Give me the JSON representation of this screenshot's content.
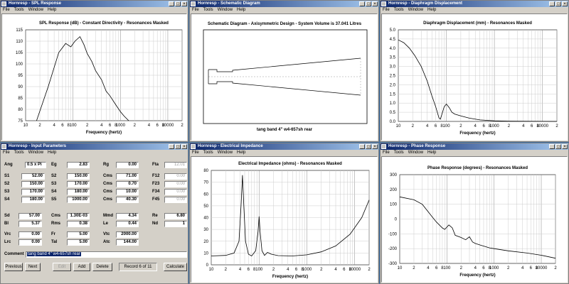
{
  "menu": [
    "File",
    "Tools",
    "Window",
    "Help"
  ],
  "windows": {
    "spl": {
      "title": "Hornresp - SPL Response"
    },
    "schematic": {
      "title": "Hornresp - Schematic Diagram"
    },
    "displacement": {
      "title": "Hornresp - Diaphragm Displacement"
    },
    "input": {
      "title": "Hornresp - Input Parameters"
    },
    "impedance": {
      "title": "Hornresp - Electrical Impedance"
    },
    "phase": {
      "title": "Hornresp - Phase Response"
    }
  },
  "log_axis": {
    "ticks": [
      "10",
      "2",
      "4",
      "6",
      "8",
      "100",
      "2",
      "4",
      "6",
      "8",
      "1000",
      "2",
      "4",
      "6",
      "8",
      "10000",
      "2"
    ],
    "label": "Frequency (hertz)"
  },
  "schematic": {
    "title": "Schematic Diagram - Axisymmetric Design - System Volume is 37.041 Litres",
    "caption": "tang band 4\" w4-657sh rear"
  },
  "input_params": {
    "row1": [
      {
        "label": "Ang",
        "value": "0.5 x Pi"
      },
      {
        "label": "Eg",
        "value": "2.83"
      },
      {
        "label": "Rg",
        "value": "0.00"
      },
      {
        "label": "Fta",
        "value": "12.01",
        "disabled": true
      }
    ],
    "block2": [
      [
        {
          "label": "S1",
          "value": "52.00"
        },
        {
          "label": "S2",
          "value": "150.00"
        },
        {
          "label": "Cms",
          "value": "71.00"
        },
        {
          "label": "F12",
          "value": "0.00",
          "disabled": true
        }
      ],
      [
        {
          "label": "S2",
          "value": "150.00"
        },
        {
          "label": "S3",
          "value": "170.00"
        },
        {
          "label": "Cms",
          "value": "0.70"
        },
        {
          "label": "F23",
          "value": "0.00",
          "disabled": true
        }
      ],
      [
        {
          "label": "S3",
          "value": "170.00"
        },
        {
          "label": "S4",
          "value": "180.00"
        },
        {
          "label": "Cms",
          "value": "10.00"
        },
        {
          "label": "F34",
          "value": "0.00",
          "disabled": true
        }
      ],
      [
        {
          "label": "S4",
          "value": "180.00"
        },
        {
          "label": "S5",
          "value": "1000.00"
        },
        {
          "label": "Cms",
          "value": "40.30"
        },
        {
          "label": "F45",
          "value": "0.00",
          "disabled": true
        }
      ]
    ],
    "block3": [
      [
        {
          "label": "Sd",
          "value": "57.00"
        },
        {
          "label": "Cms",
          "value": "1.30E-03"
        },
        {
          "label": "Mmd",
          "value": "4.34"
        },
        {
          "label": "Re",
          "value": "6.80"
        }
      ],
      [
        {
          "label": "Bl",
          "value": "5.37"
        },
        {
          "label": "Rms",
          "value": "0.38"
        },
        {
          "label": "Le",
          "value": "0.44"
        },
        {
          "label": "Nd",
          "value": "1"
        }
      ]
    ],
    "block4": [
      [
        {
          "label": "Vrc",
          "value": "0.00"
        },
        {
          "label": "Fr",
          "value": "5.00"
        },
        {
          "label": "Vtc",
          "value": "2000.00"
        }
      ],
      [
        {
          "label": "Lrc",
          "value": "0.00"
        },
        {
          "label": "Tal",
          "value": "5.00"
        },
        {
          "label": "Atc",
          "value": "144.00"
        }
      ]
    ],
    "comment_label": "Comment",
    "comment_value": "tang band 4\" w4-657sh rear",
    "buttons": {
      "previous": "Previous",
      "next": "Next",
      "edit": "Edit",
      "add": "Add",
      "delete": "Delete",
      "calculate": "Calculate"
    },
    "record": "Record 6 of 11"
  },
  "chart_data": [
    {
      "type": "line",
      "title": "SPL Response (dB) - Constant Directivity - Resonances Masked",
      "xlabel": "Frequency (hertz)",
      "x_scale": "log",
      "xlim": [
        10,
        20000
      ],
      "ylim": [
        75,
        115
      ],
      "yticks": [
        "75",
        "80",
        "85",
        "90",
        "95",
        "100",
        "105",
        "110",
        "115"
      ],
      "series": [
        {
          "values": [
            [
              17,
              75
            ],
            [
              30,
              90
            ],
            [
              50,
              105
            ],
            [
              70,
              109
            ],
            [
              90,
              107.5
            ],
            [
              110,
              110
            ],
            [
              140,
              112
            ],
            [
              170,
              108.5
            ],
            [
              200,
              104.5
            ],
            [
              250,
              101
            ],
            [
              300,
              97
            ],
            [
              400,
              93
            ],
            [
              500,
              88
            ],
            [
              600,
              86
            ],
            [
              800,
              82
            ],
            [
              1000,
              79
            ],
            [
              1200,
              77
            ],
            [
              1500,
              75
            ]
          ]
        }
      ]
    },
    {
      "type": "line",
      "title": "Diaphragm Displacement (mm) - Resonances Masked",
      "xlabel": "Frequency (hertz)",
      "x_scale": "log",
      "xlim": [
        10,
        20000
      ],
      "ylim": [
        0,
        5
      ],
      "yticks": [
        "0.0",
        "0.5",
        "1.0",
        "1.5",
        "2.0",
        "2.5",
        "3.0",
        "3.5",
        "4.0",
        "4.5",
        "5.0"
      ],
      "series": [
        {
          "values": [
            [
              10,
              4.45
            ],
            [
              13,
              4.3
            ],
            [
              17,
              4.0
            ],
            [
              22,
              3.6
            ],
            [
              30,
              3.0
            ],
            [
              40,
              2.2
            ],
            [
              50,
              1.4
            ],
            [
              60,
              0.8
            ],
            [
              70,
              0.2
            ],
            [
              75,
              0.12
            ],
            [
              80,
              0.35
            ],
            [
              90,
              0.8
            ],
            [
              100,
              0.95
            ],
            [
              115,
              0.75
            ],
            [
              130,
              0.5
            ],
            [
              150,
              0.4
            ],
            [
              200,
              0.3
            ],
            [
              300,
              0.18
            ],
            [
              500,
              0.08
            ],
            [
              1000,
              0.03
            ],
            [
              2000,
              0.01
            ],
            [
              20000,
              0.0
            ]
          ]
        }
      ]
    },
    {
      "type": "line",
      "title": "Electrical Impedance (ohms) - Resonances Masked",
      "xlabel": "Frequency (hertz)",
      "x_scale": "log",
      "xlim": [
        10,
        20000
      ],
      "ylim": [
        0,
        80
      ],
      "yticks": [
        "0",
        "10",
        "20",
        "30",
        "40",
        "50",
        "60",
        "70",
        "80"
      ],
      "series": [
        {
          "values": [
            [
              10,
              7.5
            ],
            [
              20,
              8
            ],
            [
              30,
              10
            ],
            [
              38,
              20
            ],
            [
              42,
              50
            ],
            [
              45,
              76
            ],
            [
              48,
              50
            ],
            [
              52,
              20
            ],
            [
              60,
              9
            ],
            [
              70,
              7.5
            ],
            [
              85,
              12
            ],
            [
              95,
              28
            ],
            [
              100,
              41
            ],
            [
              105,
              28
            ],
            [
              115,
              12
            ],
            [
              130,
              8
            ],
            [
              150,
              10.5
            ],
            [
              180,
              9
            ],
            [
              250,
              7.8
            ],
            [
              500,
              7.5
            ],
            [
              1000,
              8.5
            ],
            [
              2000,
              11
            ],
            [
              4000,
              16
            ],
            [
              8000,
              26
            ],
            [
              14000,
              40
            ],
            [
              20000,
              55
            ]
          ]
        }
      ]
    },
    {
      "type": "line",
      "title": "Phase Response (degrees) - Resonances Masked",
      "xlabel": "Frequency (hertz)",
      "x_scale": "log",
      "xlim": [
        10,
        20000
      ],
      "ylim": [
        -300,
        300
      ],
      "yticks": [
        "-300",
        "-200",
        "-100",
        "0",
        "100",
        "200",
        "300"
      ],
      "series": [
        {
          "values": [
            [
              10,
              150
            ],
            [
              20,
              130
            ],
            [
              30,
              100
            ],
            [
              40,
              50
            ],
            [
              50,
              10
            ],
            [
              60,
              -20
            ],
            [
              80,
              -60
            ],
            [
              90,
              -70
            ],
            [
              110,
              -40
            ],
            [
              130,
              -60
            ],
            [
              150,
              -110
            ],
            [
              200,
              -125
            ],
            [
              250,
              -140
            ],
            [
              300,
              -120
            ],
            [
              350,
              -155
            ],
            [
              400,
              -165
            ],
            [
              500,
              -175
            ],
            [
              800,
              -195
            ],
            [
              1000,
              -200
            ],
            [
              2000,
              -215
            ],
            [
              5000,
              -230
            ],
            [
              10000,
              -245
            ],
            [
              20000,
              -265
            ]
          ]
        }
      ]
    }
  ]
}
